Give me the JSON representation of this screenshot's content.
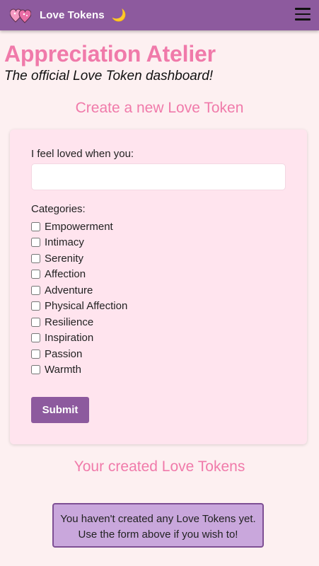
{
  "nav": {
    "brand_title": "Love Tokens",
    "moon_glyph": "🌙",
    "logo_icon": "love-tokens-hearts-logo",
    "menu_icon": "hamburger-menu-icon",
    "bar_color": "#8d5a9e"
  },
  "header": {
    "title": "Appreciation Atelier",
    "subtitle": "The official Love Token dashboard!"
  },
  "create_section": {
    "heading": "Create a new Love Token",
    "input_label": "I feel loved when you:",
    "input_value": "",
    "categories_label": "Categories:",
    "categories": [
      {
        "label": "Empowerment",
        "checked": false
      },
      {
        "label": "Intimacy",
        "checked": false
      },
      {
        "label": "Serenity",
        "checked": false
      },
      {
        "label": "Affection",
        "checked": false
      },
      {
        "label": "Adventure",
        "checked": false
      },
      {
        "label": "Physical Affection",
        "checked": false
      },
      {
        "label": "Resilience",
        "checked": false
      },
      {
        "label": "Inspiration",
        "checked": false
      },
      {
        "label": "Passion",
        "checked": false
      },
      {
        "label": "Warmth",
        "checked": false
      }
    ],
    "submit_label": "Submit"
  },
  "created_section": {
    "heading": "Your created Love Tokens",
    "empty_line1": "You haven't created any Love Tokens yet.",
    "empty_line2": "Use the form above if you wish to!"
  },
  "colors": {
    "accent_pink": "#f07aaa",
    "purple": "#8d5a9e",
    "background": "#fdf0f1",
    "card": "#ffe4ee",
    "notice_fill": "#c9a7dc"
  }
}
